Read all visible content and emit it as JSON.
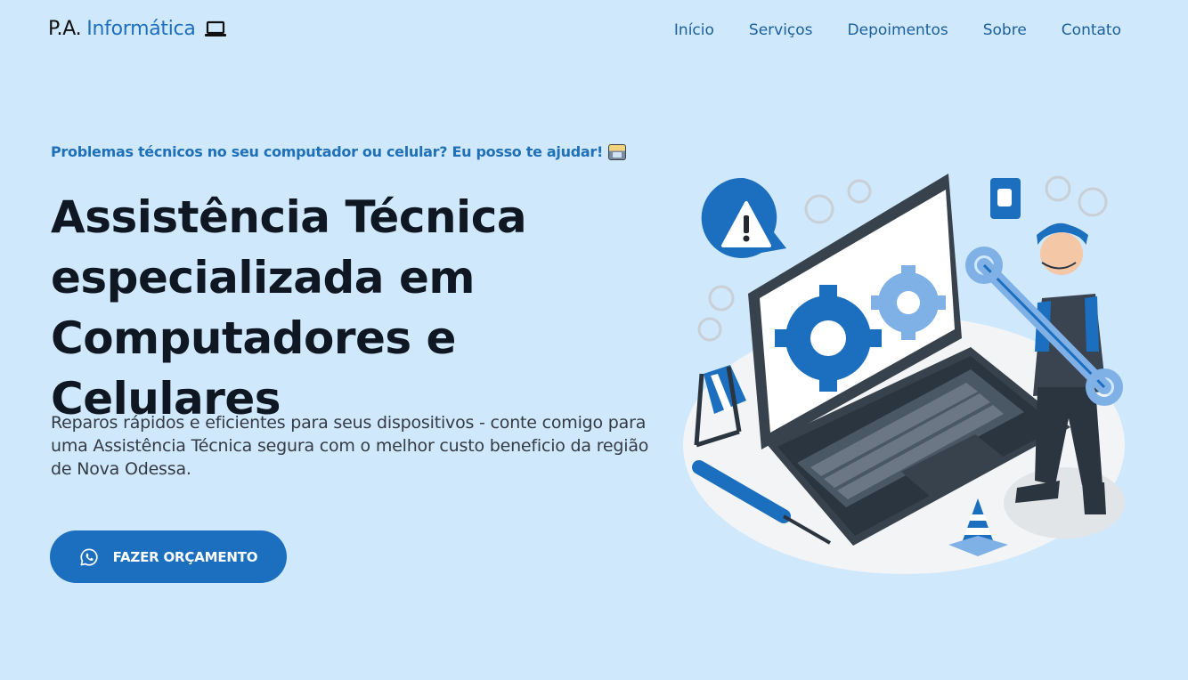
{
  "header": {
    "logo_prefix": "P.A.",
    "logo_brand": "Informática",
    "logo_icon": "laptop-icon"
  },
  "nav": {
    "items": [
      {
        "label": "Início"
      },
      {
        "label": "Serviços"
      },
      {
        "label": "Depoimentos"
      },
      {
        "label": "Sobre"
      },
      {
        "label": "Contato"
      }
    ]
  },
  "hero": {
    "tagline": "Problemas técnicos no seu computador ou celular? Eu posso te ajudar!",
    "tagline_icon": "technologist-emoji-icon",
    "headline_line1": "Assistência Técnica",
    "headline_line2": "especializada em",
    "headline_line3": "Computadores e Celulares",
    "description": "Reparos rápidos e eficientes para seus dispositivos - conte comigo para uma Assistência Técnica segura com o melhor custo beneficio da região de Nova Odessa.",
    "cta_label": "FAZER ORÇAMENTO",
    "cta_icon": "whatsapp-icon"
  },
  "colors": {
    "background": "#d0e8fb",
    "accent": "#1c6fbf",
    "nav_text": "#1a5f9e",
    "headline": "#0f1822"
  }
}
